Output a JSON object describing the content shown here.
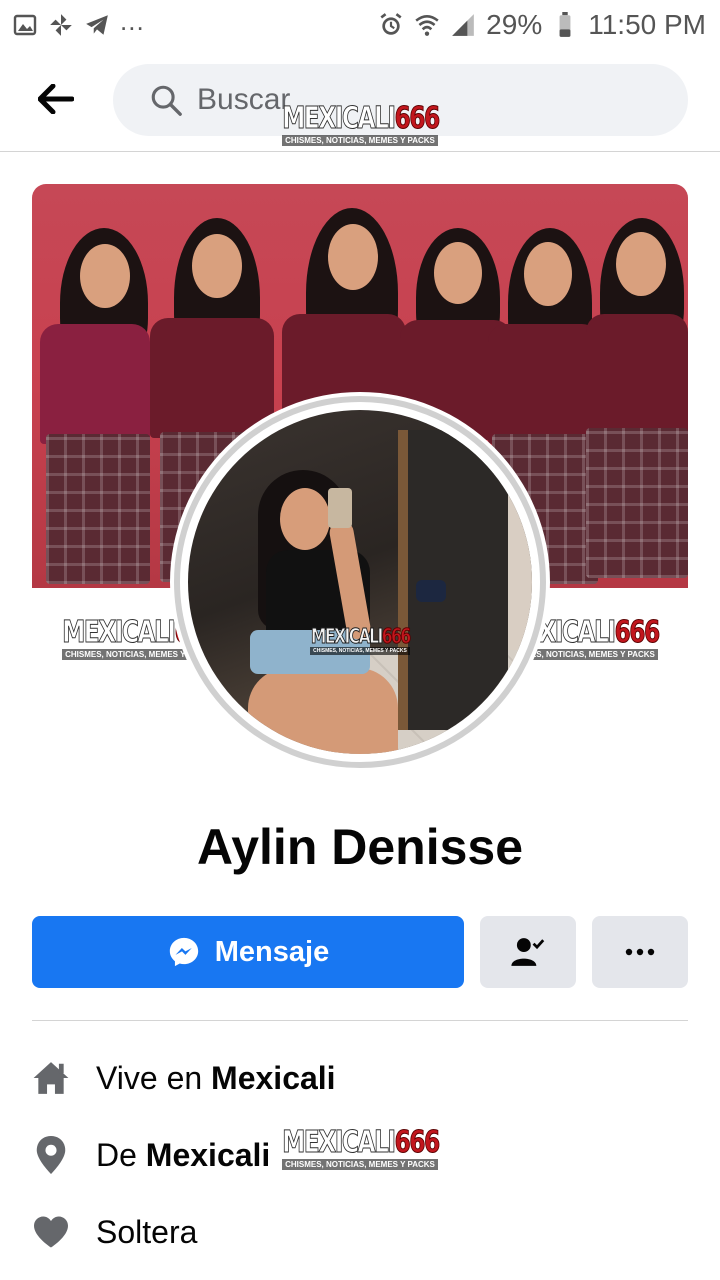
{
  "status_bar": {
    "overflow": "...",
    "battery": "29%",
    "time": "11:50 PM"
  },
  "search": {
    "placeholder": "Buscar"
  },
  "watermark": {
    "part1": "MEXICALI",
    "part2": "666",
    "tagline": "CHISMES, NOTICIAS, MEMES Y PACKS"
  },
  "profile": {
    "name": "Aylin Denisse"
  },
  "actions": {
    "message_label": "Mensaje"
  },
  "intro": {
    "lives": {
      "prefix": "Vive en ",
      "place": "Mexicali"
    },
    "from": {
      "prefix": "De ",
      "place": "Mexicali"
    },
    "relationship": "Soltera"
  },
  "colors": {
    "accent": "#1877f2",
    "icon_gray": "#65676b"
  }
}
